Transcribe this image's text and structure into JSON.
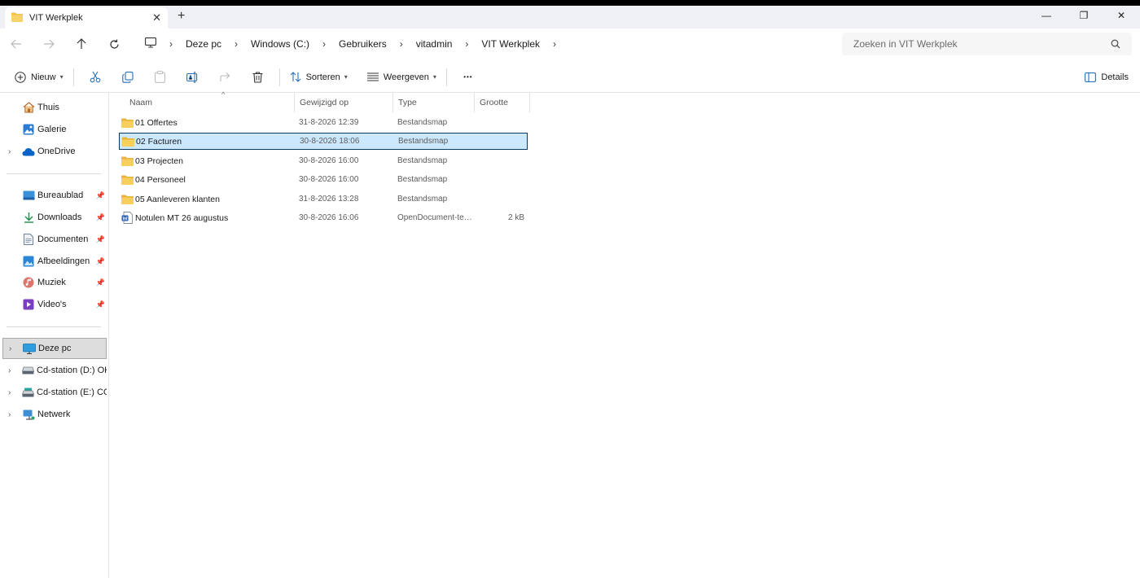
{
  "window": {
    "tab_title": "VIT Werkplek",
    "close_tab": "✕",
    "new_tab": "+",
    "minimize": "—",
    "restore": "❐",
    "close": "✕"
  },
  "breadcrumb": [
    "Deze pc",
    "Windows (C:)",
    "Gebruikers",
    "vitadmin",
    "VIT Werkplek"
  ],
  "search": {
    "placeholder": "Zoeken in VIT Werkplek"
  },
  "toolbar": {
    "new_label": "Nieuw",
    "sort_label": "Sorteren",
    "view_label": "Weergeven",
    "more_label": "•••",
    "details_label": "Details"
  },
  "sidebar": {
    "quick": [
      {
        "label": "Thuis",
        "icon": "home-icon"
      },
      {
        "label": "Galerie",
        "icon": "gallery-icon"
      },
      {
        "label": "OneDrive",
        "icon": "cloud-icon",
        "expandable": true
      }
    ],
    "pinned": [
      {
        "label": "Bureaublad",
        "icon": "desktop-icon"
      },
      {
        "label": "Downloads",
        "icon": "download-icon"
      },
      {
        "label": "Documenten",
        "icon": "document-icon"
      },
      {
        "label": "Afbeeldingen",
        "icon": "pictures-icon"
      },
      {
        "label": "Muziek",
        "icon": "music-icon"
      },
      {
        "label": "Video's",
        "icon": "video-icon"
      }
    ],
    "devices": [
      {
        "label": "Deze pc",
        "icon": "computer-icon",
        "selected": true
      },
      {
        "label": "Cd-station (D:) OK_",
        "icon": "drive-icon"
      },
      {
        "label": "Cd-station (E:) CCC",
        "icon": "drive-icon"
      },
      {
        "label": "Netwerk",
        "icon": "network-icon"
      }
    ]
  },
  "columns": {
    "name": "Naam",
    "modified": "Gewijzigd op",
    "type": "Type",
    "size": "Grootte"
  },
  "files": [
    {
      "name": "01 Offertes",
      "modified": "31-8-2026 12:39",
      "type": "Bestandsmap",
      "size": "",
      "kind": "folder"
    },
    {
      "name": "02 Facturen",
      "modified": "30-8-2026 18:06",
      "type": "Bestandsmap",
      "size": "",
      "kind": "folder",
      "selected": true
    },
    {
      "name": "03 Projecten",
      "modified": "30-8-2026 16:00",
      "type": "Bestandsmap",
      "size": "",
      "kind": "folder"
    },
    {
      "name": "04 Personeel",
      "modified": "30-8-2026 16:00",
      "type": "Bestandsmap",
      "size": "",
      "kind": "folder"
    },
    {
      "name": "05 Aanleveren klanten",
      "modified": "31-8-2026 13:28",
      "type": "Bestandsmap",
      "size": "",
      "kind": "folder"
    },
    {
      "name": "Notulen MT 26 augustus",
      "modified": "30-8-2026 16:06",
      "type": "OpenDocument-tekst",
      "size": "2 kB",
      "kind": "document"
    }
  ],
  "colors": {
    "selection": "#cce8ff",
    "folder": "#f4c24a",
    "accent": "#0067c0"
  }
}
